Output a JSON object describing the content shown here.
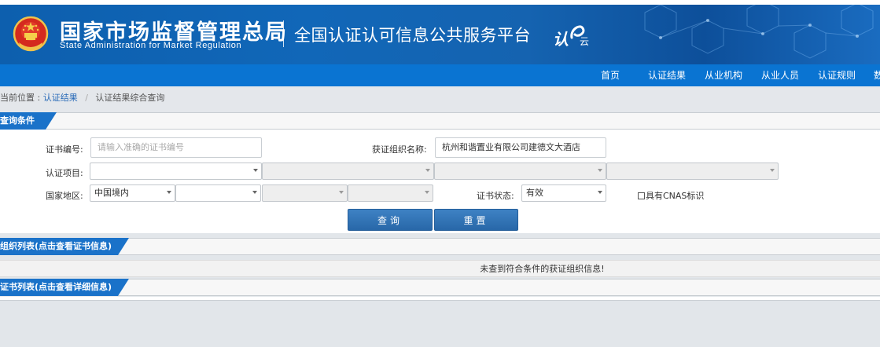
{
  "header": {
    "org_name_cn": "国家市场监督管理总局",
    "org_name_en": "State Administration  for  Market Regulation",
    "platform_title": "全国认证认可信息公共服务平台",
    "logo_text": "认",
    "logo_sub": "云"
  },
  "nav": {
    "items": [
      "首页",
      "认证结果",
      "从业机构",
      "从业人员",
      "认证规则",
      "数"
    ]
  },
  "breadcrumb": {
    "label": "当前位置 :",
    "link": "认证结果",
    "separator": "/",
    "current": "认证结果综合查询"
  },
  "query": {
    "section_title": "查询条件",
    "cert_no_label": "证书编号:",
    "cert_no_placeholder": "请输入准确的证书编号",
    "org_name_label": "获证组织名称:",
    "org_name_value": "杭州和谐置业有限公司建德文大酒店",
    "project_label": "认证项目:",
    "region_label": "国家地区:",
    "region_value": "中国境内",
    "status_label": "证书状态:",
    "status_value": "有效",
    "cnas_label": "具有CNAS标识",
    "search_button": "查询",
    "reset_button": "重置"
  },
  "org_list": {
    "section_title": "组织列表(点击查看证书信息)",
    "empty_message": "未查到符合条件的获证组织信息!"
  },
  "cert_list": {
    "section_title": "证书列表(点击查看详细信息)"
  },
  "colors": {
    "banner_blue": "#1167b8",
    "nav_blue": "#0a74d2",
    "tab_blue": "#1a72c9",
    "button_blue": "#2f73b6"
  }
}
